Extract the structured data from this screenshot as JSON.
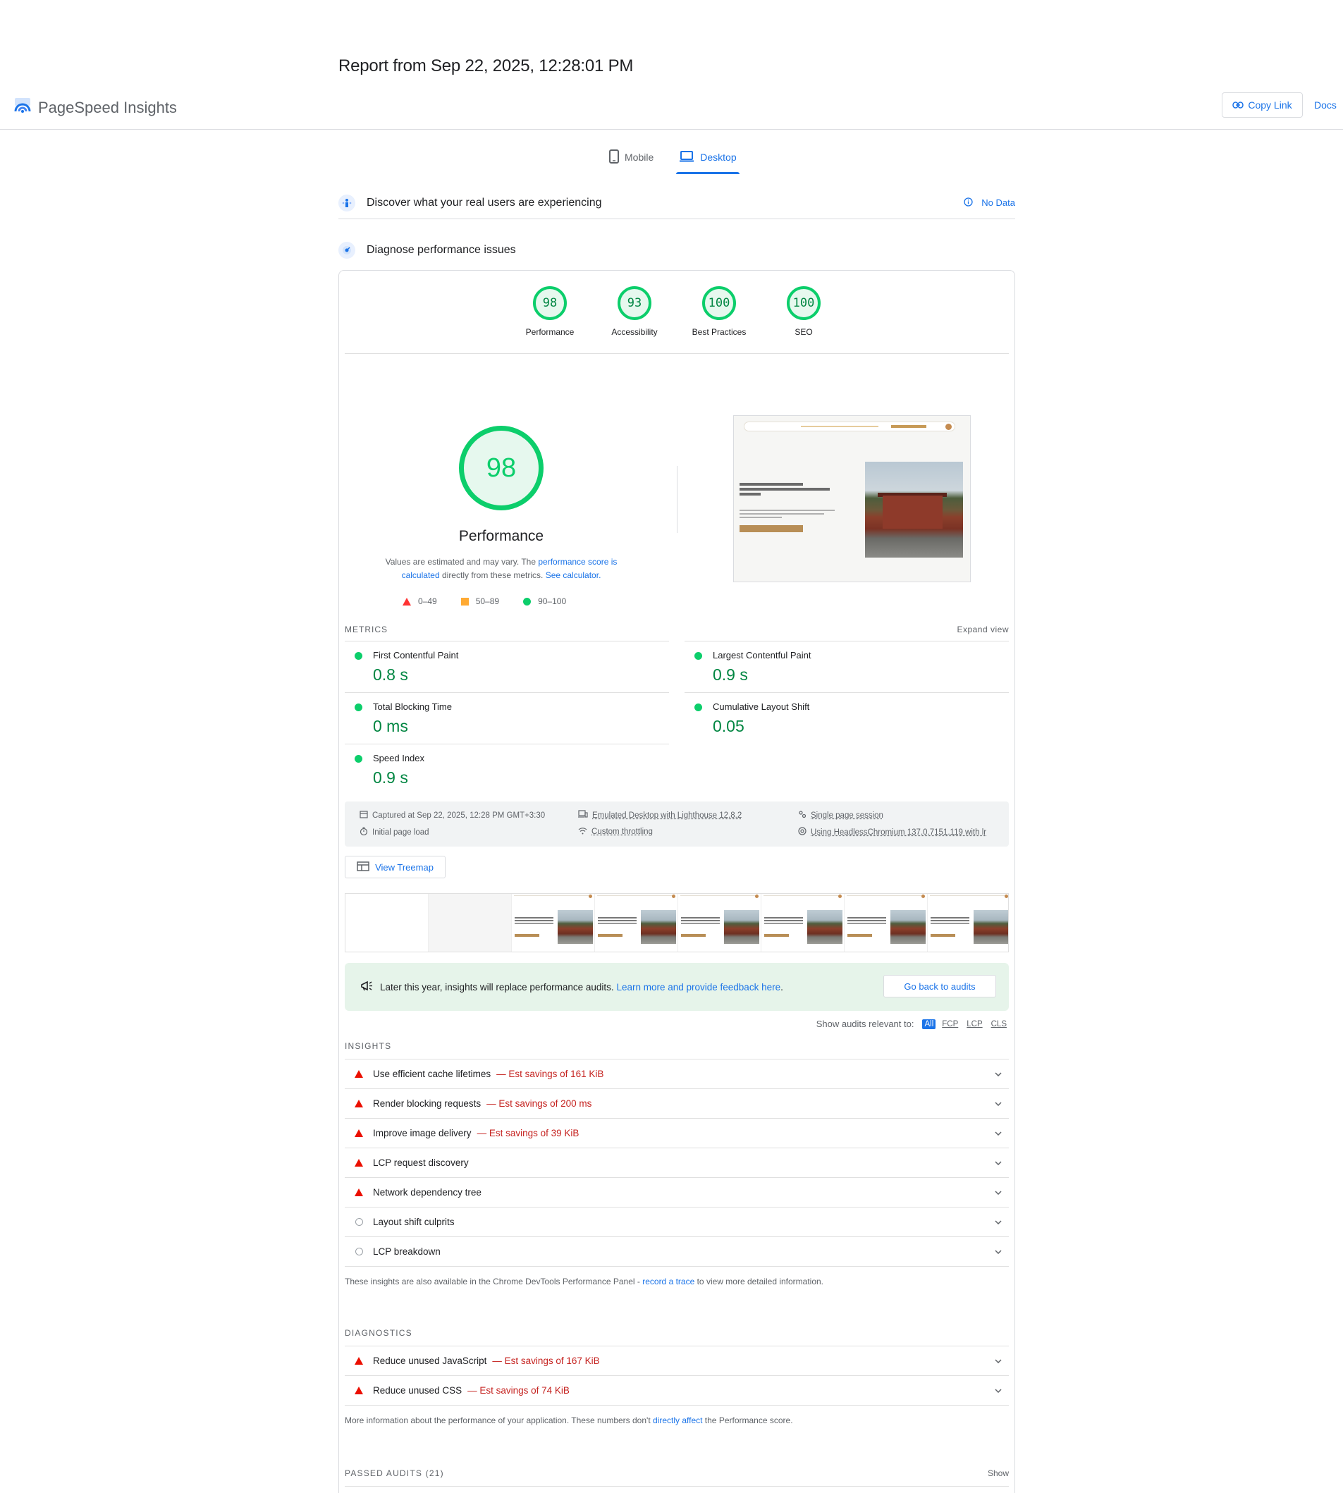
{
  "report_date": "Report from Sep 22, 2025, 12:28:01 PM",
  "header": {
    "brand": "PageSpeed Insights",
    "copy_link": "Copy Link",
    "docs": "Docs"
  },
  "tabs": [
    {
      "label": "Mobile",
      "icon": "phone-icon",
      "active": false
    },
    {
      "label": "Desktop",
      "icon": "laptop-icon",
      "active": true
    }
  ],
  "field_data": {
    "title": "Discover what your real users are experiencing",
    "status": "No Data"
  },
  "lab_data": {
    "title": "Diagnose performance issues"
  },
  "scores": [
    {
      "value": "98",
      "label": "Performance"
    },
    {
      "value": "93",
      "label": "Accessibility"
    },
    {
      "value": "100",
      "label": "Best Practices"
    },
    {
      "value": "100",
      "label": "SEO"
    }
  ],
  "performance": {
    "score": "98",
    "label": "Performance",
    "note_prefix": "Values are estimated and may vary. The ",
    "note_link1": "performance score is calculated",
    "note_mid": " directly from these metrics. ",
    "note_link2": "See calculator."
  },
  "legend": [
    {
      "shape": "triangle",
      "range": "0–49",
      "color": "#ff3333"
    },
    {
      "shape": "square",
      "range": "50–89",
      "color": "#ffaa33"
    },
    {
      "shape": "circle",
      "range": "90–100",
      "color": "#0cce6b"
    }
  ],
  "metrics_header": {
    "title": "METRICS",
    "expand": "Expand view"
  },
  "metrics": [
    {
      "name": "First Contentful Paint",
      "value": "0.8 s"
    },
    {
      "name": "Largest Contentful Paint",
      "value": "0.9 s"
    },
    {
      "name": "Total Blocking Time",
      "value": "0 ms"
    },
    {
      "name": "Cumulative Layout Shift",
      "value": "0.05"
    },
    {
      "name": "Speed Index",
      "value": "0.9 s"
    }
  ],
  "runtime": {
    "captured": "Captured at Sep 22, 2025, 12:28 PM GMT+3:30",
    "initial": "Initial page load",
    "device": "Emulated Desktop with Lighthouse 12.8.2",
    "throttling": "Custom throttling",
    "session": "Single page session",
    "browser": "Using HeadlessChromium 137.0.7151.119 with lr"
  },
  "treemap": "View Treemap",
  "notice": {
    "text": "Later this year, insights will replace performance audits. ",
    "link": "Learn more and provide feedback here",
    "end": ".",
    "button": "Go back to audits"
  },
  "filter": {
    "label": "Show audits relevant to:",
    "chips": [
      "All",
      "FCP",
      "LCP",
      "CLS"
    ]
  },
  "insights": {
    "title": "INSIGHTS",
    "items": [
      {
        "name": "Use efficient cache lifetimes",
        "saving": "— Est savings of 161 KiB",
        "status": "fail"
      },
      {
        "name": "Render blocking requests",
        "saving": "— Est savings of 200 ms",
        "status": "fail"
      },
      {
        "name": "Improve image delivery",
        "saving": "— Est savings of 39 KiB",
        "status": "fail"
      },
      {
        "name": "LCP request discovery",
        "saving": "",
        "status": "fail"
      },
      {
        "name": "Network dependency tree",
        "saving": "",
        "status": "fail"
      },
      {
        "name": "Layout shift culprits",
        "saving": "",
        "status": "info"
      },
      {
        "name": "LCP breakdown",
        "saving": "",
        "status": "info"
      }
    ],
    "foot_prefix": "These insights are also available in the Chrome DevTools Performance Panel - ",
    "foot_link": "record a trace",
    "foot_suffix": " to view more detailed information."
  },
  "diagnostics": {
    "title": "DIAGNOSTICS",
    "items": [
      {
        "name": "Reduce unused JavaScript",
        "saving": "— Est savings of 167 KiB",
        "status": "fail"
      },
      {
        "name": "Reduce unused CSS",
        "saving": "— Est savings of 74 KiB",
        "status": "fail"
      }
    ],
    "foot_prefix": "More information about the performance of your application. These numbers don't ",
    "foot_link": "directly affect",
    "foot_suffix": " the Performance score."
  },
  "passed": {
    "title": "PASSED AUDITS",
    "count": "(21)",
    "show": "Show"
  },
  "colors": {
    "accent": "#1a73e8",
    "pass": "#0cce6b",
    "fail": "#eb0f00"
  }
}
